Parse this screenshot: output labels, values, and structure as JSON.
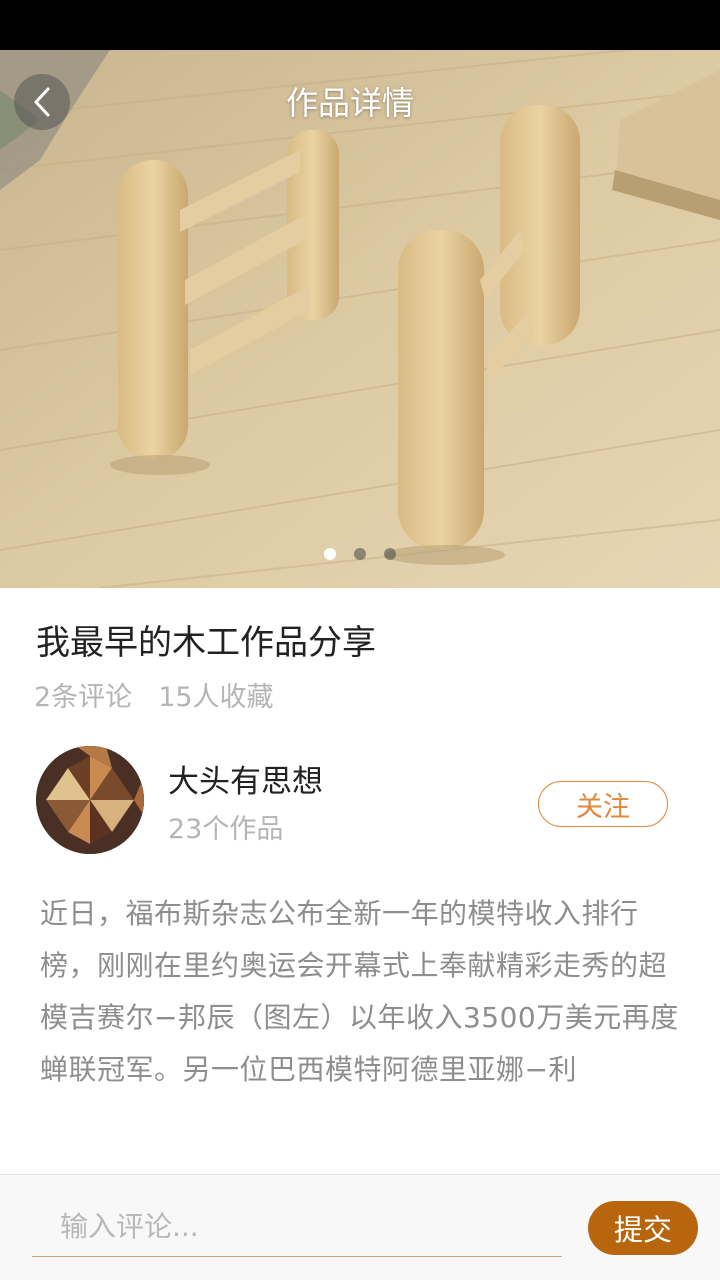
{
  "header": {
    "title": "作品详情"
  },
  "carousel": {
    "count": 3,
    "active_index": 0
  },
  "work": {
    "title": "我最早的木工作品分享",
    "comments": "2条评论",
    "favorites": "15人收藏"
  },
  "author": {
    "name": "大头有思想",
    "works": "23个作品",
    "follow_label": "关注"
  },
  "description": "近日，福布斯杂志公布全新一年的模特收入排行榜，刚刚在里约奥运会开幕式上奉献精彩走秀的超模吉赛尔−邦辰（图左）以年收入3500万美元再度蝉联冠军。另一位巴西模特阿德里亚娜−利",
  "comment_bar": {
    "placeholder": "输入评论...",
    "submit_label": "提交"
  },
  "colors": {
    "accent": "#e0883e",
    "submit": "#b8650d",
    "status_bar": "#000000"
  }
}
